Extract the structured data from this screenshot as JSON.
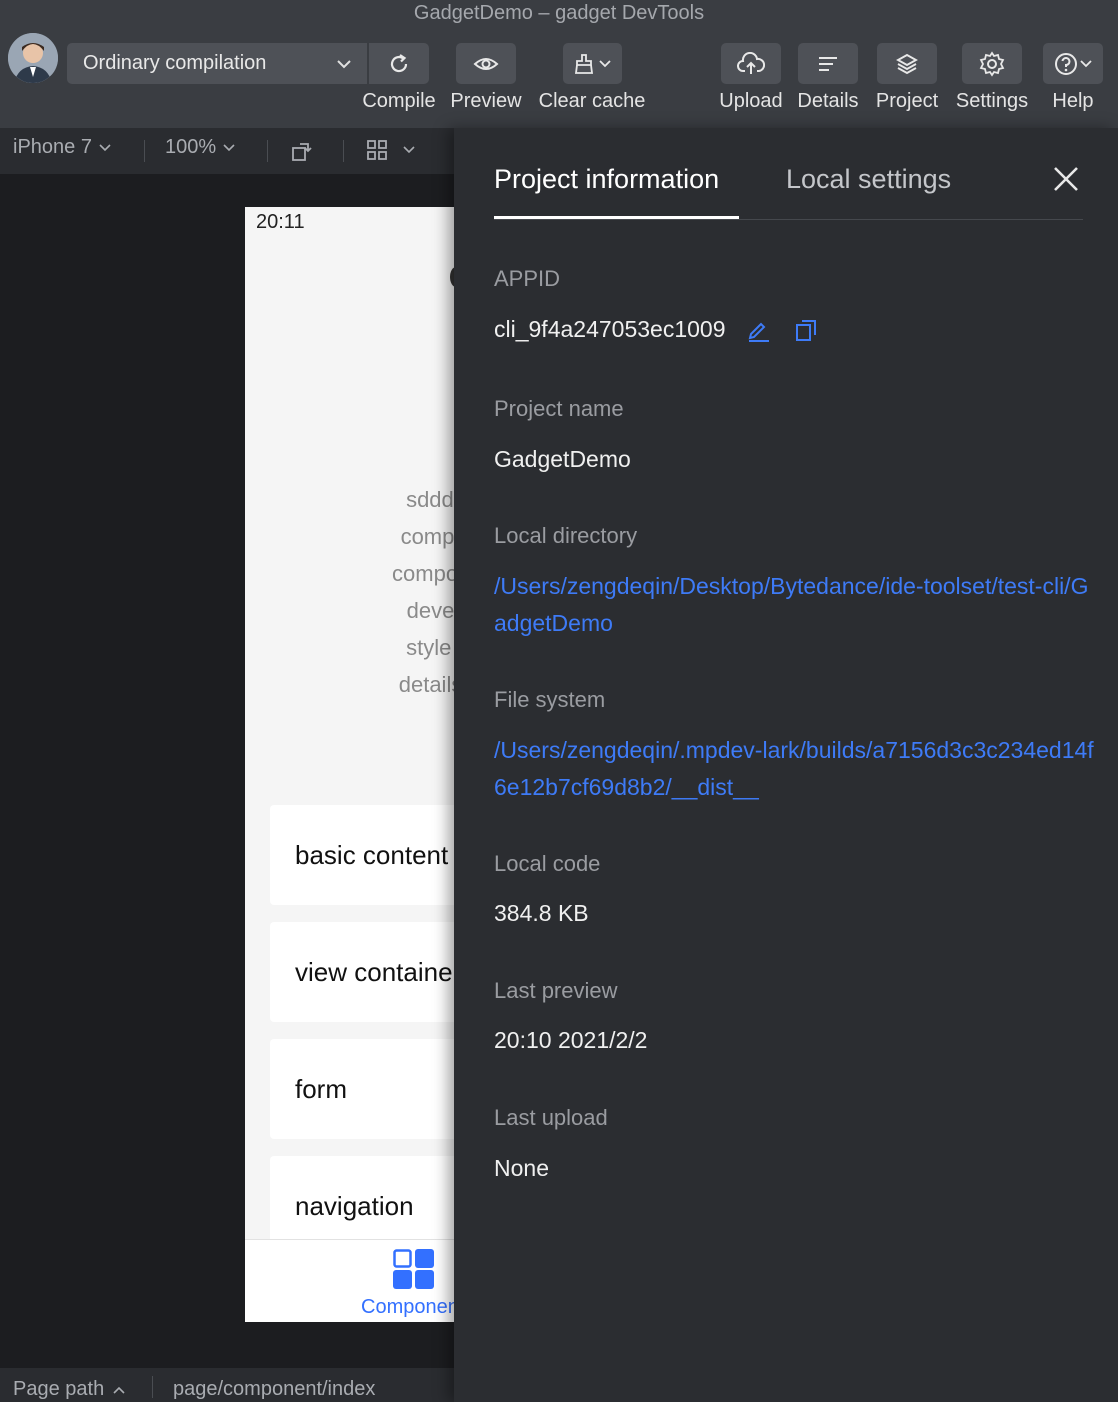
{
  "window": {
    "title": "GadgetDemo – gadget DevTools"
  },
  "toolbar": {
    "compile_mode": "Ordinary compilation",
    "buttons": [
      {
        "id": "compile",
        "label": "Compile",
        "icon": "refresh-icon"
      },
      {
        "id": "preview",
        "label": "Preview",
        "icon": "eye-icon"
      },
      {
        "id": "clear_cache",
        "label": "Clear cache",
        "icon": "broom-icon"
      },
      {
        "id": "upload",
        "label": "Upload",
        "icon": "cloud-upload-icon"
      },
      {
        "id": "details",
        "label": "Details",
        "icon": "lines-icon"
      },
      {
        "id": "project",
        "label": "Project",
        "icon": "layers-icon"
      },
      {
        "id": "settings",
        "label": "Settings",
        "icon": "gear-icon"
      },
      {
        "id": "help",
        "label": "Help",
        "icon": "help-icon"
      }
    ]
  },
  "device_bar": {
    "device": "iPhone 7",
    "zoom": "100%"
  },
  "simulator": {
    "time": "20:11",
    "description_lines": [
      "sddddThe",
      "component",
      "component s",
      "developer",
      "style acco",
      "details of th"
    ],
    "cards": [
      "basic content",
      "view container",
      "form",
      "navigation"
    ],
    "tabbar_label": "Components"
  },
  "statusbar": {
    "page_path_label": "Page path",
    "page_path": "page/component/index"
  },
  "panel": {
    "tabs": [
      "Project information",
      "Local settings"
    ],
    "fields": {
      "appid_label": "APPID",
      "appid_value": "cli_9f4a247053ec1009",
      "project_name_label": "Project name",
      "project_name_value": "GadgetDemo",
      "local_directory_label": "Local directory",
      "local_directory_value": "/Users/zengdeqin/Desktop/Bytedance/ide-toolset/test-cli/GadgetDemo",
      "file_system_label": "File system",
      "file_system_value": "/Users/zengdeqin/.mpdev-lark/builds/a7156d3c3c234ed14f6e12b7cf69d8b2/__dist__",
      "local_code_label": "Local code",
      "local_code_value": "384.8 KB",
      "last_preview_label": "Last preview",
      "last_preview_value": "20:10 2021/2/2",
      "last_upload_label": "Last upload",
      "last_upload_value": "None"
    }
  },
  "colors": {
    "accent": "#3e7bf7",
    "panel_bg": "#2b2d31",
    "toolbar_bg": "#3a3d42"
  }
}
